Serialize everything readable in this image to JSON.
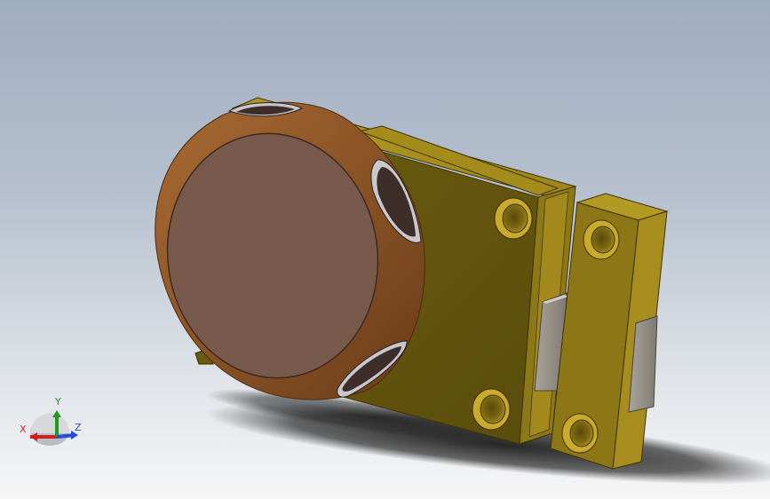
{
  "viewport": {
    "model": "cabinet-lock-assembly",
    "colors": {
      "brass": "#7c6a12",
      "brass_light": "#a98f1a",
      "brass_dark": "#4f430b",
      "knob_rim": "#8a5326",
      "knob_face": "#775a4c",
      "slot_dark": "#3e2e2a",
      "shadow": "#2a2a2a"
    }
  },
  "triad": {
    "x_label": "X",
    "y_label": "Y",
    "z_label": "Z",
    "x_color": "#d22020",
    "y_color": "#1c9c1c",
    "z_color": "#1f4fd8"
  }
}
